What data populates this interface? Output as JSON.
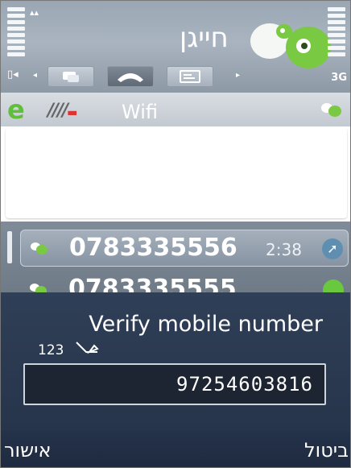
{
  "status": {
    "network_top": "3G",
    "network_label": "3G",
    "sim": "▯◂"
  },
  "header": {
    "app_title": "חייגן"
  },
  "tabs": [
    {
      "name": "messages",
      "icon": "chat-icon"
    },
    {
      "name": "calls",
      "icon": "phone-handset-icon",
      "active": true
    },
    {
      "name": "contacts",
      "icon": "card-icon"
    }
  ],
  "connection": {
    "label": "Wifi"
  },
  "calls": [
    {
      "number": "0783335556",
      "time": "2:38"
    },
    {
      "number": "0783335555",
      "time": ""
    }
  ],
  "dialog": {
    "title": "Verify mobile number",
    "input_mode": "123",
    "value": "97254603816"
  },
  "softkeys": {
    "left": "אישור",
    "right": "ביטול"
  },
  "colors": {
    "accent_green": "#6ac83f",
    "dialog_bg": "#2a3950"
  }
}
